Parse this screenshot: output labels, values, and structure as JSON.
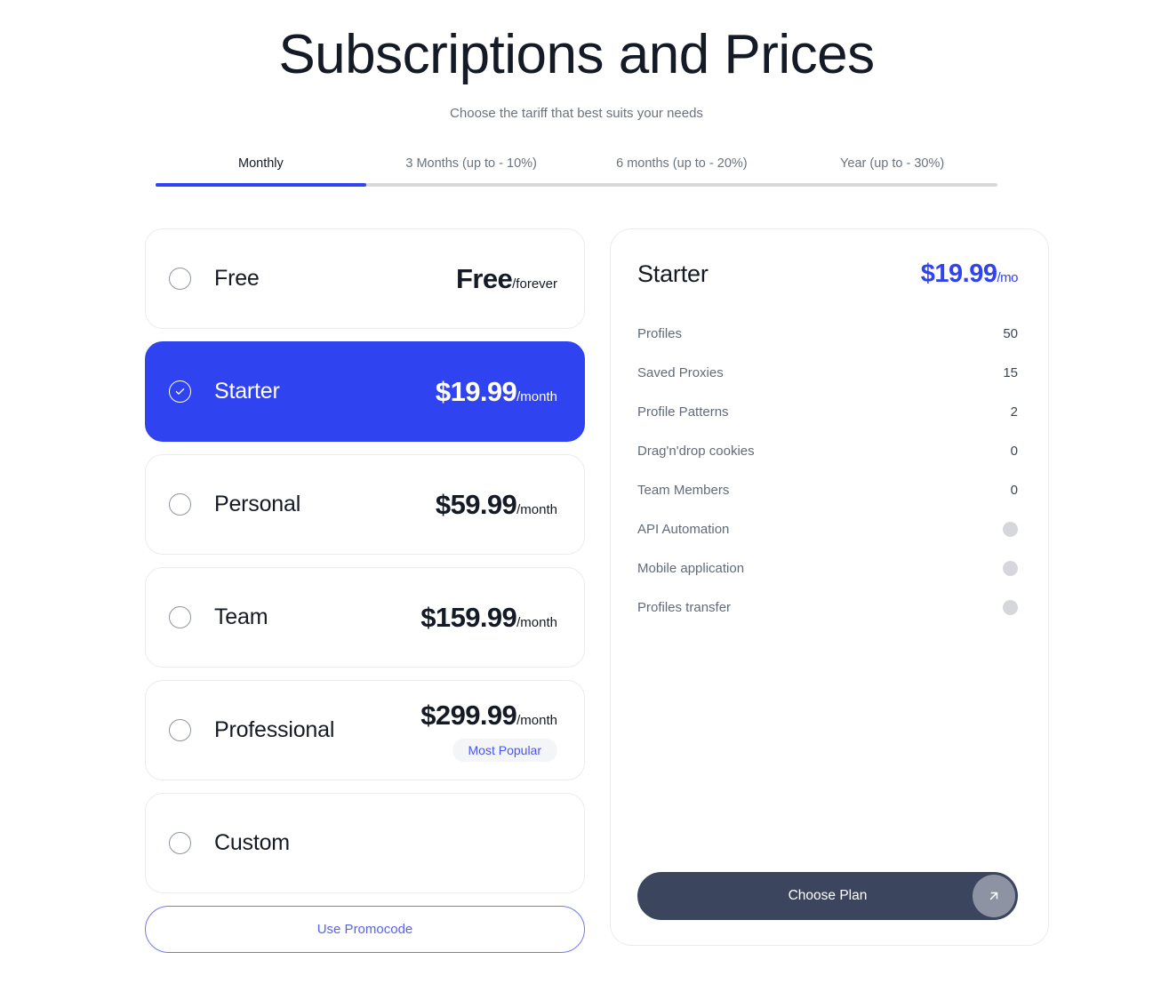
{
  "header": {
    "title": "Subscriptions and Prices",
    "subtitle": "Choose the tariff that best suits your needs"
  },
  "tabs": {
    "active_index": 0,
    "items": [
      {
        "label": "Monthly"
      },
      {
        "label": "3 Months (up to - 10%)"
      },
      {
        "label": "6 months (up to - 20%)"
      },
      {
        "label": "Year (up to - 30%)"
      }
    ]
  },
  "plans": [
    {
      "name": "Free",
      "price": "Free",
      "period": "/forever",
      "selected": false,
      "badge": null
    },
    {
      "name": "Starter",
      "price": "$19.99",
      "period": "/month",
      "selected": true,
      "badge": null
    },
    {
      "name": "Personal",
      "price": "$59.99",
      "period": "/month",
      "selected": false,
      "badge": null
    },
    {
      "name": "Team",
      "price": "$159.99",
      "period": "/month",
      "selected": false,
      "badge": null
    },
    {
      "name": "Professional",
      "price": "$299.99",
      "period": "/month",
      "selected": false,
      "badge": "Most Popular"
    },
    {
      "name": "Custom",
      "price": "",
      "period": "",
      "selected": false,
      "badge": null
    }
  ],
  "promocode_label": "Use Promocode",
  "detail": {
    "title": "Starter",
    "price": "$19.99",
    "period": "/mo",
    "features": [
      {
        "label": "Profiles",
        "value": "50",
        "type": "value"
      },
      {
        "label": "Saved Proxies",
        "value": "15",
        "type": "value"
      },
      {
        "label": "Profile Patterns",
        "value": "2",
        "type": "value"
      },
      {
        "label": "Drag'n'drop cookies",
        "value": "0",
        "type": "value"
      },
      {
        "label": "Team Members",
        "value": "0",
        "type": "value"
      },
      {
        "label": "API Automation",
        "value": "",
        "type": "dot"
      },
      {
        "label": "Mobile application",
        "value": "",
        "type": "dot"
      },
      {
        "label": "Profiles transfer",
        "value": "",
        "type": "dot"
      }
    ],
    "cta_label": "Choose Plan"
  },
  "colors": {
    "accent": "#2f43f0",
    "cta": "#3b455e",
    "muted": "#d5d7dc"
  }
}
